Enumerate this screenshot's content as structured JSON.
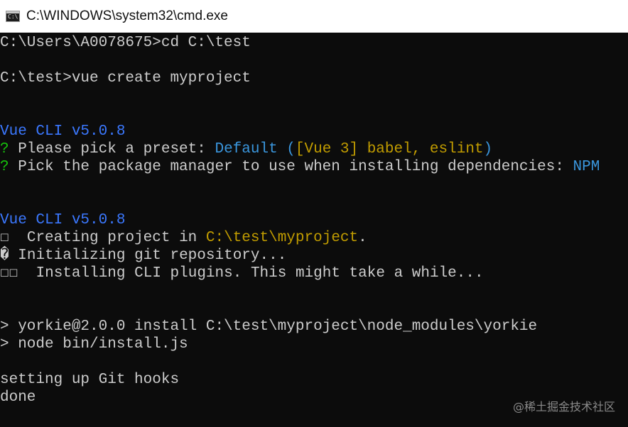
{
  "window": {
    "title": "C:\\WINDOWS\\system32\\cmd.exe",
    "icon_name": "cmd-console-icon",
    "icon_text": "C:\\"
  },
  "colors": {
    "background": "#0c0c0c",
    "text": "#cccccc",
    "vue_cli": "#3b78ff",
    "question_mark": "#16c60c",
    "answer": "#3a96dd",
    "highlight": "#c19c00"
  },
  "console": {
    "cmd1": "C:\\Users\\A0078675>cd C:\\test",
    "cmd2": "C:\\test>vue create myproject",
    "vue_cli_1": "Vue CLI v5.0.8",
    "q1_mark": "?",
    "q1_text": " Please pick a preset: ",
    "q1_answer_a": "Default (",
    "q1_answer_b": "[Vue 3] babel, eslint",
    "q1_answer_c": ")",
    "q2_mark": "?",
    "q2_text": " Pick the package manager to use when installing dependencies: ",
    "q2_answer": "NPM",
    "vue_cli_2": "Vue CLI v5.0.8",
    "creating_prefix": "☐  Creating project in ",
    "creating_path": "C:\\test\\myproject",
    "creating_suffix": ".",
    "initializing": "� Initializing git repository...",
    "installing": "☐☐  Installing CLI plugins. This might take a while...",
    "yorkie_install": "> yorkie@2.0.0 install C:\\test\\myproject\\node_modules\\yorkie",
    "node_install": "> node bin/install.js",
    "git_hooks": "setting up Git hooks",
    "done": "done"
  },
  "watermark": "@稀土掘金技术社区"
}
